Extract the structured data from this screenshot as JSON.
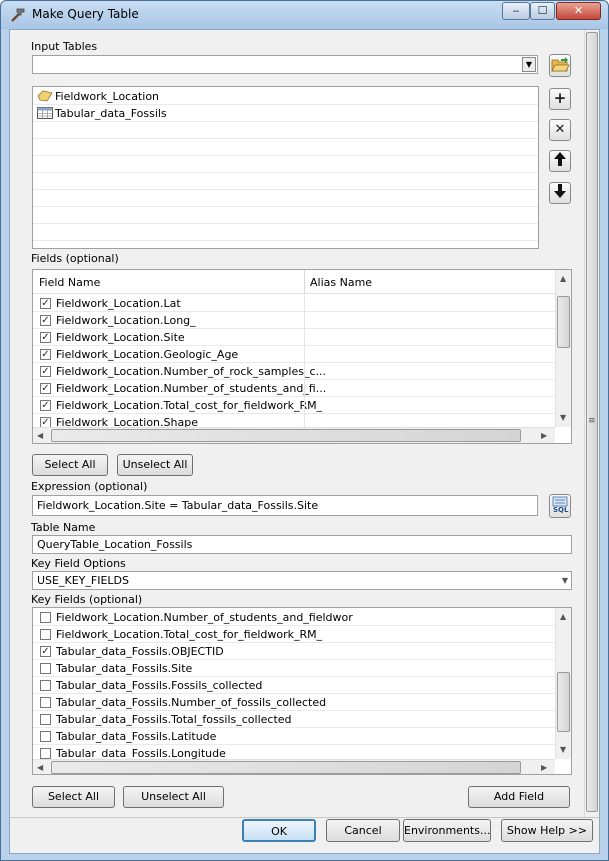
{
  "window": {
    "title": "Make Query Table",
    "minimize": "‒",
    "maximize": "☐",
    "close": "✕"
  },
  "input_tables": {
    "label": "Input Tables",
    "value": "",
    "items": [
      {
        "name": "Fieldwork_Location",
        "icon": "feature-class-icon"
      },
      {
        "name": "Tabular_data_Fossils",
        "icon": "table-icon"
      }
    ]
  },
  "side_buttons": {
    "add": "+",
    "remove": "✕",
    "up": "🡑",
    "down": "🡓"
  },
  "fields": {
    "label": "Fields (optional)",
    "col_field": "Field Name",
    "col_alias": "Alias Name",
    "rows": [
      {
        "name": "Fieldwork_Location.Lat",
        "checked": true
      },
      {
        "name": "Fieldwork_Location.Long_",
        "checked": true
      },
      {
        "name": "Fieldwork_Location.Site",
        "checked": true
      },
      {
        "name": "Fieldwork_Location.Geologic_Age",
        "checked": true
      },
      {
        "name": "Fieldwork_Location.Number_of_rock_samples_c...",
        "checked": true
      },
      {
        "name": "Fieldwork_Location.Number_of_students_and_fi...",
        "checked": true
      },
      {
        "name": "Fieldwork_Location.Total_cost_for_fieldwork_RM_",
        "checked": true
      },
      {
        "name": "Fieldwork_Location.Shape",
        "checked": true
      }
    ],
    "select_all": "Select All",
    "unselect_all": "Unselect All"
  },
  "expression": {
    "label": "Expression (optional)",
    "value": "Fieldwork_Location.Site = Tabular_data_Fossils.Site",
    "sql_button": "SQL"
  },
  "table_name": {
    "label": "Table Name",
    "value": "QueryTable_Location_Fossils"
  },
  "key_field_options": {
    "label": "Key Field Options",
    "value": "USE_KEY_FIELDS"
  },
  "key_fields": {
    "label": "Key Fields (optional)",
    "rows": [
      {
        "name": "Fieldwork_Location.Number_of_students_and_fieldwor",
        "checked": false
      },
      {
        "name": "Fieldwork_Location.Total_cost_for_fieldwork_RM_",
        "checked": false
      },
      {
        "name": "Tabular_data_Fossils.OBJECTID",
        "checked": true
      },
      {
        "name": "Tabular_data_Fossils.Site",
        "checked": false
      },
      {
        "name": "Tabular_data_Fossils.Fossils_collected",
        "checked": false
      },
      {
        "name": "Tabular_data_Fossils.Number_of_fossils_collected",
        "checked": false
      },
      {
        "name": "Tabular_data_Fossils.Total_fossils_collected",
        "checked": false
      },
      {
        "name": "Tabular_data_Fossils.Latitude",
        "checked": false
      },
      {
        "name": "Tabular_data_Fossils.Longitude",
        "checked": false
      }
    ],
    "select_all": "Select All",
    "unselect_all": "Unselect All",
    "add_field": "Add Field"
  },
  "footer": {
    "ok": "OK",
    "cancel": "Cancel",
    "environments": "Environments...",
    "show_help": "Show Help >>"
  },
  "colors": {
    "title_bar": "#b9d1ea",
    "panel": "#f0f0f0",
    "close_button": "#c4473a",
    "ok_focus": "#3c7fb1"
  }
}
